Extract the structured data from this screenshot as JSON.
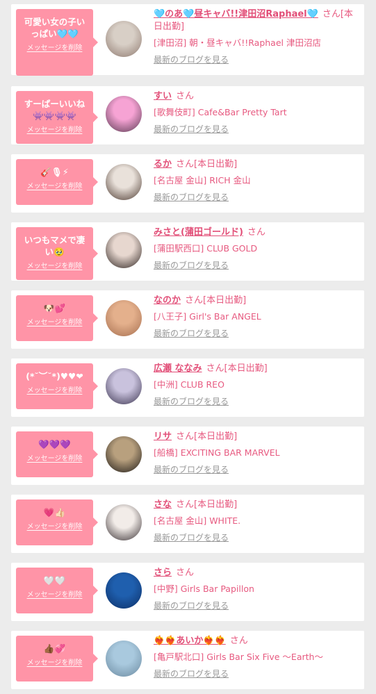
{
  "delete_label": "メッセージを削除",
  "blog_label": "最新のブログを見る",
  "cards": [
    {
      "message": "可愛い女の子いっぱい🩵🩵",
      "name": "🩵のあ🩵昼キャバ!!津田沼Raphael🩵",
      "suffix": "さん[本日出勤]",
      "shop": "[津田沼] 朝・昼キャバ!!Raphael 津田沼店",
      "avatar_colors": [
        "#d8cfc6",
        "#8f7a70"
      ]
    },
    {
      "message": "すーぱーいいね👾👾👾👾",
      "name": "すい",
      "suffix": "さん",
      "shop": "[歌舞伎町] Cafe&Bar Pretty Tart",
      "avatar_colors": [
        "#f6a3d4",
        "#5a3a52"
      ]
    },
    {
      "message": "🎸🎙⚡",
      "name": "るか",
      "suffix": "さん[本日出勤]",
      "shop": "[名古屋 金山] RICH 金山",
      "avatar_colors": [
        "#e9e1da",
        "#4e3b32"
      ]
    },
    {
      "message": "いつもマメで凄い🥹",
      "name": "みさと(蒲田ゴールド)",
      "suffix": "さん",
      "shop": "[蒲田駅西口] CLUB GOLD",
      "avatar_colors": [
        "#e7d7cf",
        "#302623"
      ]
    },
    {
      "message": "🐶💕",
      "name": "なのか",
      "suffix": "さん[本日出勤]",
      "shop": "[八王子] Girl's Bar ANGEL",
      "avatar_colors": [
        "#e4b08c",
        "#a66f50"
      ]
    },
    {
      "message": "(*˘︶˘*)♥♥❤",
      "name": "広瀬 ななみ",
      "suffix": "さん[本日出勤]",
      "shop": "[中洲] CLUB REO",
      "avatar_colors": [
        "#c9c2dd",
        "#3c3550"
      ]
    },
    {
      "message": "💜💜💜",
      "name": "リサ",
      "suffix": "さん[本日出勤]",
      "shop": "[船橋] EXCITING BAR MARVEL",
      "avatar_colors": [
        "#b8a07e",
        "#1e1a17"
      ]
    },
    {
      "message": "💗👍🏻",
      "name": "さな",
      "suffix": "さん[本日出勤]",
      "shop": "[名古屋 金山] WHITE.",
      "avatar_colors": [
        "#f2ece8",
        "#3a3235"
      ]
    },
    {
      "message": "🤍🤍",
      "name": "さら",
      "suffix": "さん",
      "shop": "[中野] Girls Bar Papillon",
      "avatar_colors": [
        "#1f5fae",
        "#0d2f66"
      ]
    },
    {
      "message": "👍🏾💞",
      "name": "❤️‍🔥❤️‍🔥あいか❤️‍🔥❤️‍🔥",
      "suffix": "さん",
      "shop": "[亀戸駅北口] Girls Bar Six Five 〜Earth〜",
      "avatar_colors": [
        "#a9c9de",
        "#6b8aa0"
      ]
    }
  ]
}
